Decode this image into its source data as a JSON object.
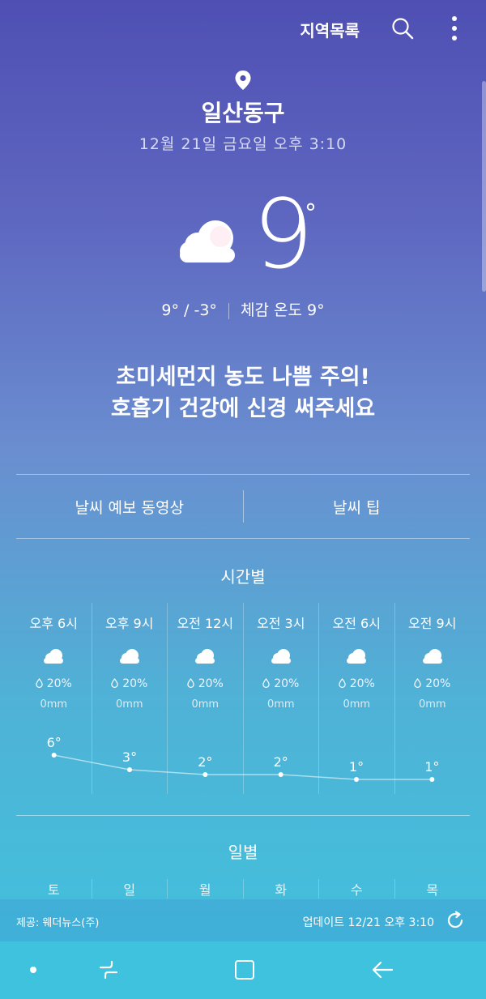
{
  "header": {
    "region_list_label": "지역목록",
    "search_icon": "search-icon",
    "more_icon": "more-vert-icon"
  },
  "current": {
    "location": "일산동구",
    "datetime": "12월 21일 금요일 오후 3:10",
    "condition_icon": "cloud-icon",
    "temperature": "9",
    "degree_symbol": "°",
    "high_low": "9° / -3°",
    "feels_like": "체감 온도 9°",
    "alert_line1": "초미세먼지 농도 나쁨 주의!",
    "alert_line2": "호흡기 건강에 신경 써주세요"
  },
  "links": {
    "forecast_video": "날씨 예보 동영상",
    "weather_tip": "날씨 팁"
  },
  "hourly": {
    "title": "시간별",
    "items": [
      {
        "time": "오후 6시",
        "icon": "cloud-icon",
        "precip": "20%",
        "amount": "0mm",
        "temp": "6°"
      },
      {
        "time": "오후 9시",
        "icon": "cloud-icon",
        "precip": "20%",
        "amount": "0mm",
        "temp": "3°"
      },
      {
        "time": "오전 12시",
        "icon": "cloud-icon",
        "precip": "20%",
        "amount": "0mm",
        "temp": "2°"
      },
      {
        "time": "오전 3시",
        "icon": "cloud-icon",
        "precip": "20%",
        "amount": "0mm",
        "temp": "2°"
      },
      {
        "time": "오전 6시",
        "icon": "cloud-icon",
        "precip": "20%",
        "amount": "0mm",
        "temp": "1°"
      },
      {
        "time": "오전 9시",
        "icon": "cloud-icon",
        "precip": "20%",
        "amount": "0mm",
        "temp": "1°"
      }
    ],
    "temps_values": [
      6,
      3,
      2,
      2,
      1,
      1
    ]
  },
  "daily": {
    "title": "일별",
    "days_partial": [
      "토",
      "일",
      "월",
      "화",
      "수",
      "목"
    ]
  },
  "footer": {
    "provider": "제공: 웨더뉴스(주)",
    "updated": "업데이트 12/21 오후 3:10",
    "refresh_icon": "refresh-icon"
  },
  "navbar": {
    "icons": [
      "nav-dot-icon",
      "recent-apps-icon",
      "home-icon",
      "back-icon"
    ]
  },
  "colors": {
    "gradient_top": "#4f4fb3",
    "gradient_bottom": "#3fc3de"
  }
}
